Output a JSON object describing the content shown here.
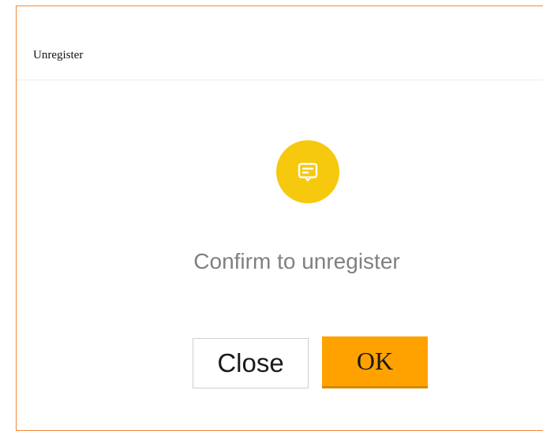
{
  "dialog": {
    "title": "Unregister",
    "message": "Confirm to unregister",
    "icon": "message-icon",
    "close_label": "Close",
    "ok_label": "OK"
  },
  "colors": {
    "accent": "#ffa200",
    "icon_bg": "#f6c90e",
    "border": "#f0883a"
  }
}
